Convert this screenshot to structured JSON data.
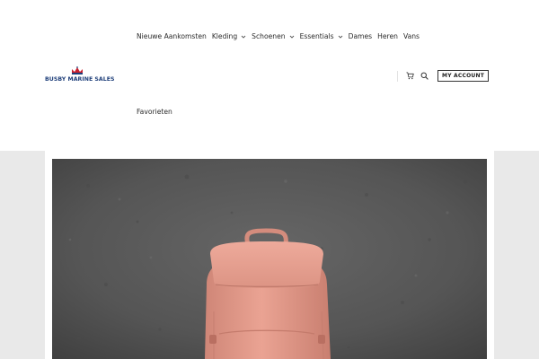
{
  "brand": {
    "name": "BUSBY MARINE SALES",
    "colors": {
      "navy": "#1f3f7a",
      "red": "#c8202f"
    }
  },
  "nav": {
    "items": [
      {
        "label": "Nieuwe Aankomsten",
        "has_dropdown": false
      },
      {
        "label": "Kleding",
        "has_dropdown": true
      },
      {
        "label": "Schoenen",
        "has_dropdown": true
      },
      {
        "label": "Essentials",
        "has_dropdown": true
      },
      {
        "label": "Dames",
        "has_dropdown": false
      },
      {
        "label": "Heren",
        "has_dropdown": false
      },
      {
        "label": "Vans",
        "has_dropdown": false
      }
    ],
    "second_row": {
      "label": "Favorieten"
    }
  },
  "header_actions": {
    "cart_icon": "cart-icon",
    "search_icon": "search-icon",
    "account_label": "MY ACCOUNT"
  },
  "hero": {
    "subject": "pink backpack on dark concrete background",
    "colors": {
      "background": "#565656",
      "backpack": "#e39a8a"
    }
  }
}
